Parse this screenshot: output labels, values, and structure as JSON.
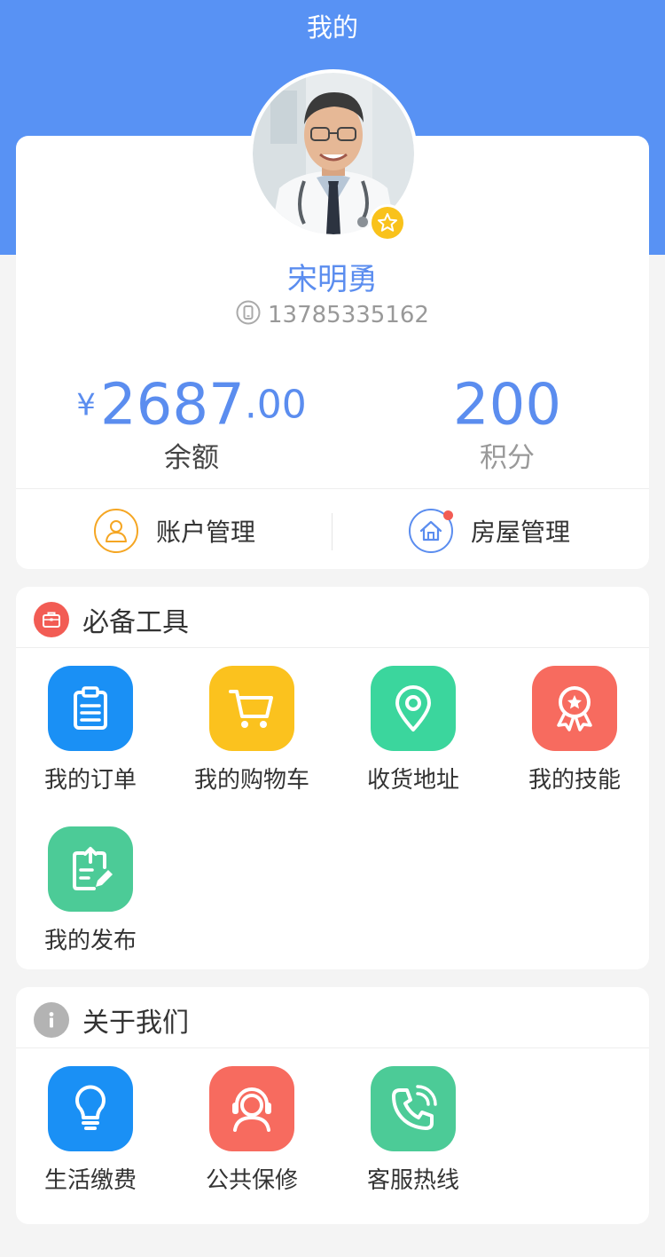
{
  "header": {
    "title": "我的"
  },
  "profile": {
    "name": "宋明勇",
    "phone": "13785335162",
    "avatar_icon": "doctor-avatar",
    "badge_icon": "star-badge-icon"
  },
  "stats": {
    "balance": {
      "currency": "¥",
      "integer": "2687",
      "decimal": ".00",
      "label": "余额"
    },
    "points": {
      "value": "200",
      "label": "积分"
    }
  },
  "management": {
    "account_label": "账户管理",
    "house_label": "房屋管理"
  },
  "tools": {
    "title": "必备工具",
    "items": [
      {
        "label": "我的订单",
        "icon": "clipboard-icon",
        "color": "#1a90f5"
      },
      {
        "label": "我的购物车",
        "icon": "cart-icon",
        "color": "#fbc21e"
      },
      {
        "label": "收货地址",
        "icon": "location-pin-icon",
        "color": "#3bd69d"
      },
      {
        "label": "我的技能",
        "icon": "award-ribbon-icon",
        "color": "#f76b5f"
      },
      {
        "label": "我的发布",
        "icon": "publish-edit-icon",
        "color": "#4ccb97"
      }
    ]
  },
  "about": {
    "title": "关于我们",
    "items": [
      {
        "label": "生活缴费",
        "icon": "lightbulb-icon",
        "color": "#1a90f5"
      },
      {
        "label": "公共保修",
        "icon": "headset-service-icon",
        "color": "#f76b5f"
      },
      {
        "label": "客服热线",
        "icon": "phone-call-icon",
        "color": "#4ccb97"
      }
    ]
  },
  "colors": {
    "header_bg": "#5892f4",
    "accent_blue": "#5b8def",
    "page_bg": "#f4f4f4"
  }
}
